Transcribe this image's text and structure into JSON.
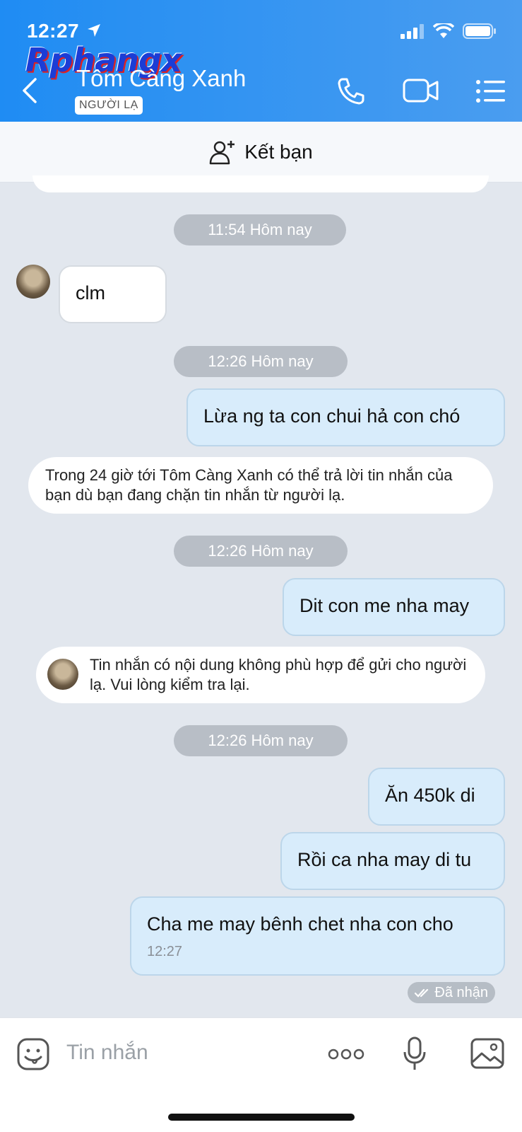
{
  "status_bar": {
    "time": "12:27"
  },
  "watermark": "Rphangx",
  "header": {
    "contact_name": "Tôm Càng Xanh",
    "badge": "NGƯỜI LẠ"
  },
  "add_friend": {
    "label": "Kết bạn"
  },
  "messages": {
    "chip1": "11:54 Hôm nay",
    "msg1": "clm",
    "chip2": "12:26 Hôm nay",
    "msg2": "Lừa ng ta con chui hả con chó",
    "notice1": "Trong 24 giờ tới Tôm Càng Xanh có thể trả lời tin nhắn của bạn dù bạn đang chặn tin nhắn từ người lạ.",
    "chip3": "12:26 Hôm nay",
    "msg3": "Dit con me nha may",
    "notice2": "Tin nhắn có nội dung không phù hợp để gửi cho người lạ. Vui lòng kiểm tra lại.",
    "chip4": "12:26 Hôm nay",
    "msg4": "Ăn 450k di",
    "msg5": "Rồi ca nha may di tu",
    "msg6": "Cha me may bênh chet nha con cho",
    "msg6_time": "12:27",
    "received": "Đã nhận"
  },
  "input": {
    "placeholder": "Tin nhắn"
  },
  "colors": {
    "header_start": "#1f8cf3",
    "header_end": "#4a9df0",
    "out_bubble": "#d8ecfb",
    "chat_bg": "#e2e7ee"
  }
}
